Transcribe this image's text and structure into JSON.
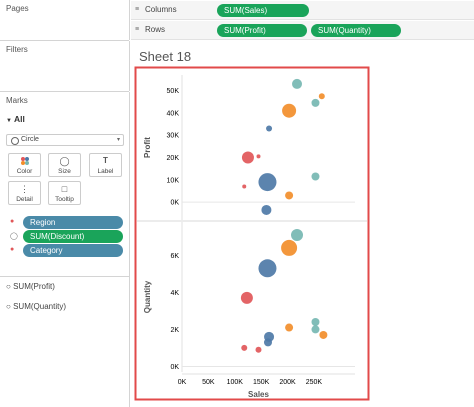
{
  "pages": {
    "title": "Pages"
  },
  "filters": {
    "title": "Filters"
  },
  "marks": {
    "title": "Marks",
    "all_label": "All",
    "mark_type": "Circle",
    "buttons": [
      {
        "label": "Color",
        "icon": "color-icon"
      },
      {
        "label": "Size",
        "icon": "size-icon"
      },
      {
        "label": "Label",
        "icon": "label-icon"
      },
      {
        "label": "Detail",
        "icon": "detail-icon"
      },
      {
        "label": "Tooltip",
        "icon": "tooltip-icon"
      }
    ],
    "fields": [
      "Region",
      "SUM(Discount)",
      "Category"
    ],
    "field_colors": {
      "Region": "#4a8aa8",
      "SUM(Discount)": "#1aa45a",
      "Category": "#4a8aa8"
    },
    "cards": [
      "SUM(Profit)",
      "SUM(Quantity)"
    ]
  },
  "shelves": {
    "columns_label": "Columns",
    "rows_label": "Rows",
    "columns_pill": "SUM(Sales)",
    "rows_pills": [
      "SUM(Profit)",
      "SUM(Quantity)"
    ]
  },
  "sheet": {
    "title": "Sheet 18"
  },
  "chart_data": {
    "type": "scatter",
    "x_label": "Sales",
    "x_ticks": [
      "0K",
      "50K",
      "100K",
      "150K",
      "200K",
      "250K"
    ],
    "x_range": [
      0,
      290000
    ],
    "colors": {
      "blue": "#4e79a7",
      "orange": "#f28e2b",
      "red": "#e15759",
      "teal": "#76b7b2"
    },
    "panes": [
      {
        "y_label": "Profit",
        "y_ticks": [
          "0K",
          "10K",
          "20K",
          "30K",
          "40K",
          "50K"
        ],
        "y_tick_values": [
          0,
          10000,
          20000,
          30000,
          40000,
          50000
        ],
        "y_range": [
          -8000,
          57000
        ],
        "points": [
          {
            "x": 218000,
            "y": 53000,
            "color": "teal",
            "size": 5
          },
          {
            "x": 265000,
            "y": 47500,
            "color": "orange",
            "size": 3
          },
          {
            "x": 253000,
            "y": 44500,
            "color": "teal",
            "size": 4
          },
          {
            "x": 203000,
            "y": 41000,
            "color": "orange",
            "size": 7
          },
          {
            "x": 165000,
            "y": 33000,
            "color": "blue",
            "size": 3
          },
          {
            "x": 125000,
            "y": 20000,
            "color": "red",
            "size": 6
          },
          {
            "x": 145000,
            "y": 20500,
            "color": "red",
            "size": 2
          },
          {
            "x": 253000,
            "y": 11500,
            "color": "teal",
            "size": 4
          },
          {
            "x": 162000,
            "y": 9000,
            "color": "blue",
            "size": 9
          },
          {
            "x": 118000,
            "y": 7000,
            "color": "red",
            "size": 2
          },
          {
            "x": 203000,
            "y": 3000,
            "color": "orange",
            "size": 4
          },
          {
            "x": 160000,
            "y": -3500,
            "color": "blue",
            "size": 5
          }
        ]
      },
      {
        "y_label": "Quantity",
        "y_ticks": [
          "0K",
          "2K",
          "4K",
          "6K"
        ],
        "y_tick_values": [
          0,
          2000,
          4000,
          6000
        ],
        "y_range": [
          -300,
          7800
        ],
        "points": [
          {
            "x": 218000,
            "y": 7100,
            "color": "teal",
            "size": 6
          },
          {
            "x": 203000,
            "y": 6400,
            "color": "orange",
            "size": 8
          },
          {
            "x": 162000,
            "y": 5300,
            "color": "blue",
            "size": 9
          },
          {
            "x": 123000,
            "y": 3700,
            "color": "red",
            "size": 6
          },
          {
            "x": 253000,
            "y": 2400,
            "color": "teal",
            "size": 4
          },
          {
            "x": 203000,
            "y": 2100,
            "color": "orange",
            "size": 4
          },
          {
            "x": 253000,
            "y": 2000,
            "color": "teal",
            "size": 4
          },
          {
            "x": 165000,
            "y": 1600,
            "color": "blue",
            "size": 5
          },
          {
            "x": 268000,
            "y": 1700,
            "color": "orange",
            "size": 4
          },
          {
            "x": 163000,
            "y": 1300,
            "color": "blue",
            "size": 4
          },
          {
            "x": 118000,
            "y": 1000,
            "color": "red",
            "size": 3
          },
          {
            "x": 145000,
            "y": 900,
            "color": "red",
            "size": 3
          }
        ]
      }
    ]
  }
}
